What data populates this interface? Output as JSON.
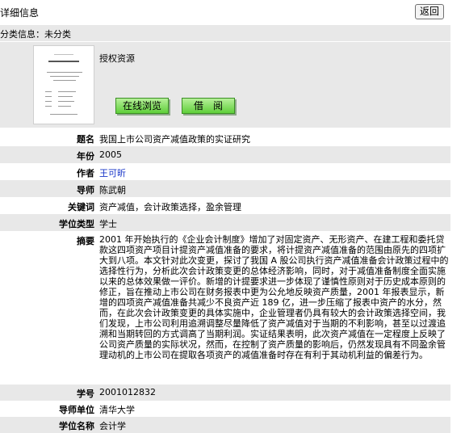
{
  "header": {
    "title": "详细信息",
    "back_label": "返回"
  },
  "category": {
    "text": "分类信息：未分类"
  },
  "resource": {
    "auth_label": "授权资源",
    "online_label": "在线浏览",
    "borrow_label": "借　阅"
  },
  "fields": {
    "title_label": "题名",
    "title_value": "我国上市公司资产减值政策的实证研究",
    "year_label": "年份",
    "year_value": "2005",
    "author_label": "作者",
    "author_value": "王可昕",
    "advisor_label": "导师",
    "advisor_value": "陈武朝",
    "keywords_label": "关键词",
    "keywords_value": "资产减值，会计政策选择，盈余管理",
    "degree_label": "学位类型",
    "degree_value": "学士",
    "abstract_label": "摘要",
    "abstract_value": "2001 年开始执行的《企业会计制度》增加了对固定资产、无形资产、在建工程和委托贷款这四项资产项目计提资产减值准备的要求，将计提资产减值准备的范围由原先的四项扩大到八项。本文针对此次变更，探讨了我国 A 股公司执行资产减值准备会计政策过程中的选择性行为，分析此次会计政策变更的总体经济影响，同时，对于减值准备制度全面实施以来的总体效果做一评价。新增的计提要求进一步体现了谨慎性原则对于历史成本原则的修正，旨在推动上市公司在财务报表中更为公允地反映资产质量，2001 年报表显示，新增的四项资产减值准备共减少不良资产近 189 亿，进一步压缩了报表中资产的水分，然而，在此次会计政策变更的具体实施中，企业管理者仍具有较大的会计政策选择空间，我们发现，上市公司利用追溯调整尽量降低了资产减值对于当期的不利影响，甚至以过渡追溯和当期转回的方式调高了当期利润。实证结果表明，此次资产减值在一定程度上反映了公司资产质量的实际状况，然而，在控制了资产质量的影响后，仍然发现具有不同盈余管理动机的上市公司在提取各项资产的减值准备时存在有利于其动机利益的偏差行为。",
    "student_id_label": "学号",
    "student_id_value": "2001012832",
    "unit_label": "导师单位",
    "unit_value": "清华大学",
    "major_label": "学位名称",
    "major_value": "会计学"
  }
}
